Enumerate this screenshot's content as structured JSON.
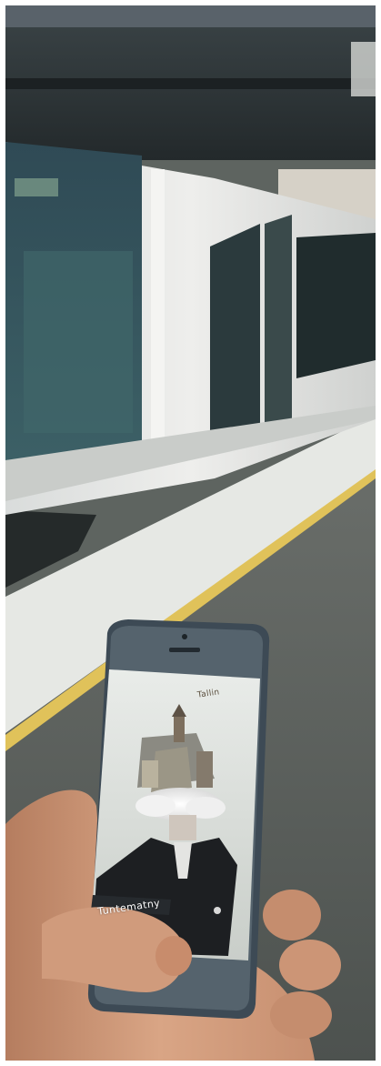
{
  "photo": {
    "subject": "hand-holding-smartphone-on-metro-platform",
    "colors": {
      "platform_line": "#e0c25a",
      "train_body": "#e7e7e5",
      "phone_frame": "#3d4a55"
    }
  },
  "phone_screen": {
    "logo_text": "Tallin",
    "caption": "Tuntematny"
  }
}
